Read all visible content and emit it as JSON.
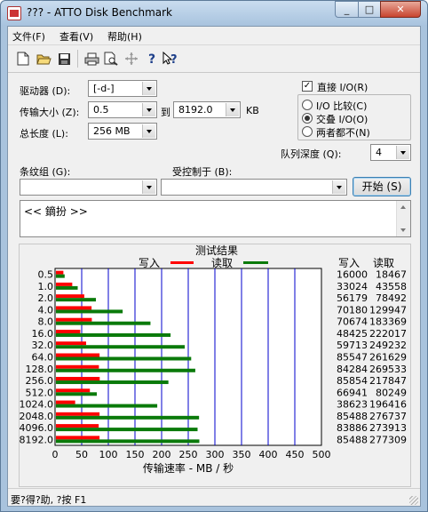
{
  "window": {
    "title": "??? - ATTO Disk Benchmark"
  },
  "menu": [
    {
      "label": "文件(F)"
    },
    {
      "label": "查看(V)"
    },
    {
      "label": "帮助(H)"
    }
  ],
  "toolbar_icons": [
    "new-file-icon",
    "open-folder-icon",
    "save-icon",
    "print-icon",
    "print-preview-icon",
    "move-icon",
    "help-icon",
    "context-help-icon"
  ],
  "form": {
    "drive_label": "驱动器 (D):",
    "drive_value": "[-d-]",
    "transfer_size_label": "传输大小 (Z):",
    "transfer_from": "0.5",
    "to_label": "到",
    "transfer_to": "8192.0",
    "transfer_unit": "KB",
    "total_length_label": "总长度 (L):",
    "total_length_value": "256 MB",
    "direct_io_label": "直接 I/O(R)",
    "direct_io_checked": true,
    "radio_compare_label": "I/O 比较(C)",
    "radio_overlap_label": "交叠 I/O(O)",
    "radio_neither_label": "两者都不(N)",
    "radio_selected": "overlap",
    "queue_depth_label": "队列深度 (Q):",
    "queue_depth_value": "4",
    "stripe_group_label": "条纹组 (G):",
    "stripe_group_value": "",
    "controlled_by_label": "受控制于 (B):",
    "controlled_by_value": "",
    "start_button": "开始 (S)",
    "description_text": "<< 鏑扮 >>"
  },
  "results": {
    "title": "测试结果",
    "legend_write": "写入",
    "legend_read": "读取",
    "col_write": "写入",
    "col_read": "读取",
    "xlabel": "传输速率 - MB / 秒",
    "write_color": "#ff0000",
    "read_color": "#0a7a0a"
  },
  "chart_data": {
    "type": "bar",
    "orientation": "horizontal",
    "categories": [
      "0.5",
      "1.0",
      "2.0",
      "4.0",
      "8.0",
      "16.0",
      "32.0",
      "64.0",
      "128.0",
      "256.0",
      "512.0",
      "1024.0",
      "2048.0",
      "4096.0",
      "8192.0"
    ],
    "series": [
      {
        "name": "写入",
        "values_kb": [
          16000,
          33024,
          56179,
          70180,
          70674,
          48425,
          59713,
          85547,
          84284,
          85854,
          66941,
          38623,
          85488,
          83886,
          85488
        ]
      },
      {
        "name": "读取",
        "values_kb": [
          18467,
          43558,
          78492,
          129947,
          183369,
          222017,
          249232,
          261629,
          269533,
          217847,
          80249,
          196416,
          276737,
          273913,
          277309
        ]
      }
    ],
    "x_ticks": [
      0,
      50,
      100,
      150,
      200,
      250,
      300,
      350,
      400,
      450,
      500
    ],
    "xlim": [
      0,
      500
    ],
    "xlabel": "传输速率 - MB / 秒"
  },
  "status": {
    "text": "要?得?助, ?按 F1"
  }
}
